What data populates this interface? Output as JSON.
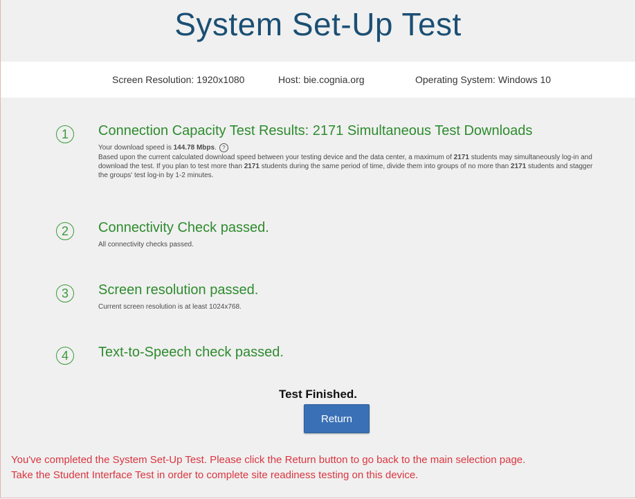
{
  "title": "System Set-Up Test",
  "info": {
    "resolution": "Screen Resolution: 1920x1080",
    "host": "Host: bie.cognia.org",
    "os": "Operating System: Windows 10"
  },
  "steps": [
    {
      "num": "1",
      "heading": "Connection Capacity Test Results: 2171 Simultaneous Test Downloads",
      "speed_prefix": "Your download speed is ",
      "speed_value": "144.78 Mbps",
      "speed_suffix": ".",
      "help_icon": "?",
      "body_1": "Based upon the current calculated download speed between your testing device and the data center, a maximum of ",
      "body_2": "2171",
      "body_3": " students may simultaneously log-in and download the test. If you plan to test more than ",
      "body_4": "2171",
      "body_5": " students during the same period of time, divide them into groups of no more than ",
      "body_6": "2171",
      "body_7": " students and stagger the groups' test log-in by 1-2 minutes."
    },
    {
      "num": "2",
      "heading": "Connectivity Check passed.",
      "sub": "All connectivity checks passed."
    },
    {
      "num": "3",
      "heading": "Screen resolution passed.",
      "sub": "Current screen resolution is at least 1024x768."
    },
    {
      "num": "4",
      "heading": "Text-to-Speech check passed."
    }
  ],
  "finished": "Test Finished.",
  "return_label": "Return",
  "message_line1": "You've completed the System Set-Up Test. Please click the Return button to go back to the main selection page.",
  "message_line2": "Take the Student Interface Test in order to complete site readiness testing on this device.",
  "colors": {
    "title": "#1b4f74",
    "step_green": "#2e8b2e",
    "button": "#3a71b6",
    "message_red": "#d9353f"
  }
}
